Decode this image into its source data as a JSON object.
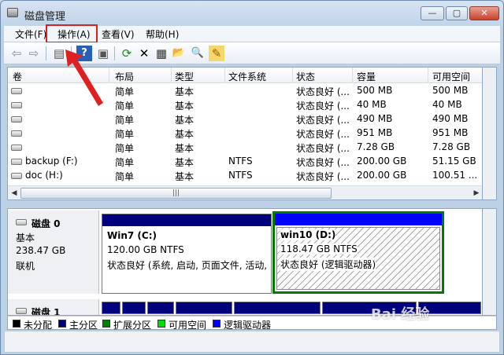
{
  "window": {
    "title": "磁盘管理",
    "min_glyph": "—",
    "max_glyph": "▢",
    "close_glyph": "✕"
  },
  "menu": [
    {
      "label": "文件(F)"
    },
    {
      "label": "操作(A)"
    },
    {
      "label": "查看(V)"
    },
    {
      "label": "帮助(H)"
    }
  ],
  "toolbar": {
    "icons": [
      "back-icon",
      "forward-icon",
      "console-icon",
      "help-icon",
      "panel-icon",
      "refresh-icon",
      "delete-icon",
      "properties-icon",
      "open-folder-icon",
      "search-icon",
      "wizard-icon"
    ],
    "glyphs": {
      "back": "⇦",
      "forward": "⇨",
      "console": "▤",
      "help": "?",
      "panel": "▣",
      "refresh": "⟳",
      "delete": "✕",
      "properties": "▦",
      "open": "📂",
      "search": "🔍",
      "wizard": "✎"
    }
  },
  "volumes": {
    "headers": [
      "卷",
      "布局",
      "类型",
      "文件系统",
      "状态",
      "容量",
      "可用空间"
    ],
    "rows": [
      {
        "name": "",
        "layout": "简单",
        "type": "基本",
        "fs": "",
        "status": "状态良好 (...",
        "capacity": "500 MB",
        "free": "500 MB"
      },
      {
        "name": "",
        "layout": "简单",
        "type": "基本",
        "fs": "",
        "status": "状态良好 (...",
        "capacity": "40 MB",
        "free": "40 MB"
      },
      {
        "name": "",
        "layout": "简单",
        "type": "基本",
        "fs": "",
        "status": "状态良好 (...",
        "capacity": "490 MB",
        "free": "490 MB"
      },
      {
        "name": "",
        "layout": "简单",
        "type": "基本",
        "fs": "",
        "status": "状态良好 (...",
        "capacity": "951 MB",
        "free": "951 MB"
      },
      {
        "name": "",
        "layout": "简单",
        "type": "基本",
        "fs": "",
        "status": "状态良好 (...",
        "capacity": "7.28 GB",
        "free": "7.28 GB"
      },
      {
        "name": "backup (F:)",
        "layout": "简单",
        "type": "基本",
        "fs": "NTFS",
        "status": "状态良好 (...",
        "capacity": "200.00 GB",
        "free": "51.15 GB"
      },
      {
        "name": "doc (H:)",
        "layout": "简单",
        "type": "基本",
        "fs": "NTFS",
        "status": "状态良好 (...",
        "capacity": "200.00 GB",
        "free": "100.51 ..."
      }
    ]
  },
  "disks": [
    {
      "name": "磁盘 0",
      "kind": "基本",
      "size": "238.47 GB",
      "state": "联机",
      "partitions": [
        {
          "name": "Win7  (C:)",
          "size": "120.00 GB NTFS",
          "status": "状态良好 (系统, 启动, 页面文件, 活动,",
          "color": "#00007f"
        },
        {
          "name": "win10  (D:)",
          "size": "118.47 GB NTFS",
          "status": "状态良好 (逻辑驱动器)",
          "color": "#0000ff"
        }
      ]
    },
    {
      "name": "磁盘 1"
    }
  ],
  "legend": [
    {
      "label": "未分配",
      "color": "#000000"
    },
    {
      "label": "主分区",
      "color": "#00007f"
    },
    {
      "label": "扩展分区",
      "color": "#008000"
    },
    {
      "label": "可用空间",
      "color": "#00e000"
    },
    {
      "label": "逻辑驱动器",
      "color": "#0000ff"
    }
  ],
  "watermark": "Bai 经验",
  "colors": {
    "highlight_box": "#e02020",
    "extended_border": "#007a00"
  }
}
